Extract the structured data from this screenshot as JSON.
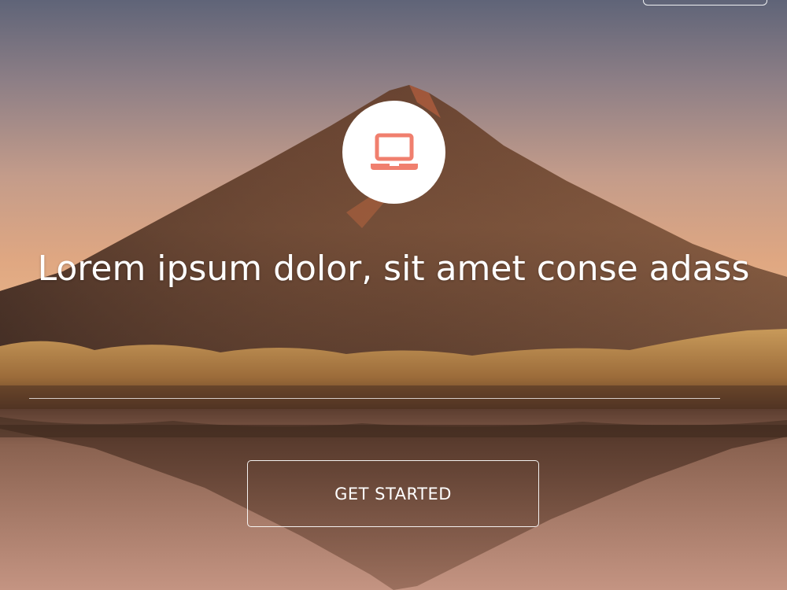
{
  "hero": {
    "headline": "Lorem ipsum dolor, sit amet conse adass",
    "icon": "laptop-icon",
    "cta_label": "GET STARTED"
  },
  "colors": {
    "accent": "#f07f6e",
    "text": "#ffffff"
  }
}
